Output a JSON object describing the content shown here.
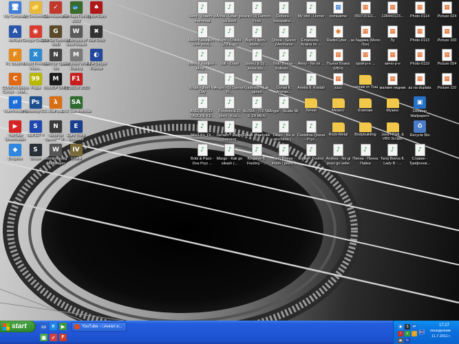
{
  "desktop": {
    "icons": [
      {
        "label": "My Computer",
        "glyph": "🖥",
        "color": "#3f7fd8",
        "kind": "app"
      },
      {
        "label": "My Documents",
        "glyph": "📁",
        "color": "#e9b93c",
        "kind": "app"
      },
      {
        "label": "Checklauncher",
        "glyph": "✓",
        "color": "#c0392b",
        "kind": "app"
      },
      {
        "label": "Pro Bass Fishing 2003",
        "glyph": "🐟",
        "color": "#3a6b2a",
        "kind": "app"
      },
      {
        "label": "PokerStars",
        "glyph": "♠",
        "color": "#b01818",
        "kind": "app"
      },
      {
        "label": "AvRack",
        "glyph": "A",
        "color": "#2a55a8",
        "kind": "app"
      },
      {
        "label": "Google Chrome",
        "glyph": "◉",
        "color": "#d93b2f",
        "kind": "app"
      },
      {
        "label": "GTA SA Turbo XD MoD",
        "glyph": "G",
        "color": "#5a4a2a",
        "kind": "app"
      },
      {
        "label": "In Wheels of Steel Haulin",
        "glyph": "W",
        "color": "#5a5a5a",
        "kind": "app"
      },
      {
        "label": "War Rock",
        "glyph": "✖",
        "color": "#333333",
        "kind": "app"
      },
      {
        "label": "FL Studio 9",
        "glyph": "F",
        "color": "#e58a1c",
        "kind": "app"
      },
      {
        "label": "Xilisoft Free AVI Video...",
        "glyph": "X",
        "color": "#2e8ad0",
        "kind": "app"
      },
      {
        "label": "Need for Speed Nfs",
        "glyph": "N",
        "color": "#444444",
        "kind": "app"
      },
      {
        "label": "Mercedes World Racing",
        "glyph": "M",
        "color": "#7a7a7a",
        "kind": "app"
      },
      {
        "label": "FIFA Simple Parlour",
        "glyph": "◐",
        "color": "#22479c",
        "kind": "app"
      },
      {
        "label": "COWON Media Center - JetA...",
        "glyph": "C",
        "color": "#e0680f",
        "kind": "app"
      },
      {
        "label": "Fraps",
        "glyph": "99",
        "color": "#b8b800",
        "kind": "app"
      },
      {
        "label": "MotoGP URT3",
        "glyph": "M",
        "color": "#1a1a1a",
        "kind": "app"
      },
      {
        "label": "F1 DELIX 2010",
        "glyph": "F1",
        "color": "#c81e1e",
        "kind": "app"
      },
      {
        "label": "TeamViewer 6",
        "glyph": "⇄",
        "color": "#1c6fd8",
        "kind": "app"
      },
      {
        "label": "Photoshop CS...",
        "glyph": "Ps",
        "color": "#1d4f8e",
        "kind": "app"
      },
      {
        "label": "Half-Life",
        "glyph": "λ",
        "color": "#d86f14",
        "kind": "app"
      },
      {
        "label": "GTA San Andreas",
        "glyph": "SA",
        "color": "#2f6b2f",
        "kind": "app"
      },
      {
        "label": "YouTube Downloader",
        "glyph": "▶",
        "color": "#d62424",
        "kind": "app"
      },
      {
        "label": "SUPER ©",
        "glyph": "S",
        "color": "#1e48b0",
        "kind": "app"
      },
      {
        "label": "Need for Speed™ M...",
        "glyph": "N",
        "color": "#3a3a3a",
        "kind": "app"
      },
      {
        "label": "Euro Truck Simulator",
        "glyph": "E",
        "color": "#1b3f8f",
        "kind": "app"
      },
      {
        "label": "Dropbox",
        "glyph": "◆",
        "color": "#2f87e0",
        "kind": "app"
      },
      {
        "label": "Steam",
        "glyph": "S",
        "color": "#2a3038",
        "kind": "app"
      },
      {
        "label": "World Racing Multiplayer",
        "glyph": "W",
        "color": "#555555",
        "kind": "app"
      },
      {
        "label": "GTA 4",
        "glyph": "IV",
        "color": "#7a6a3a",
        "kind": "app"
      },
      {
        "label": "Vanq - Znaem si momenat",
        "glyph": "♪",
        "color": "#1e8a3a",
        "kind": "doc"
      },
      {
        "label": "Anna - Udari go na kivot",
        "glyph": "♪",
        "color": "#1e8a3a",
        "kind": "doc"
      },
      {
        "label": "Vanq i Dj Damon-Prob",
        "glyph": "♪",
        "color": "#1e8a3a",
        "kind": "doc"
      },
      {
        "label": "Debora - Sekspalno ...",
        "glyph": "♪",
        "color": "#1e8a3a",
        "kind": "doc"
      },
      {
        "label": "My Idol - Homer",
        "glyph": "♪",
        "color": "#1e8a3a",
        "kind": "doc"
      },
      {
        "label": "comeatme",
        "glyph": "▦",
        "color": "#2670c8",
        "kind": "img"
      },
      {
        "label": "050720111...",
        "glyph": "▦",
        "color": "#e05a10",
        "kind": "img"
      },
      {
        "label": "128440123...",
        "glyph": "▦",
        "color": "#e05a10",
        "kind": "img"
      },
      {
        "label": "Photo-0114",
        "glyph": "▦",
        "color": "#e05a10",
        "kind": "img"
      },
      {
        "label": "Picture 024",
        "glyph": "▦",
        "color": "#e05a10",
        "kind": "img"
      },
      {
        "label": "Milko Kalaidjiev - Shte povq...",
        "glyph": "♪",
        "color": "#1e8a3a",
        "kind": "doc"
      },
      {
        "label": "Bigni - Chikita (ZU Rap)",
        "glyph": "♪",
        "color": "#1e8a3a",
        "kind": "doc"
      },
      {
        "label": "Bigni Filipov - Malko ...",
        "glyph": "♪",
        "color": "#1e8a3a",
        "kind": "doc"
      },
      {
        "label": "Qnica - Sezon ZAnimanie",
        "glyph": "♪",
        "color": "#1e8a3a",
        "kind": "doc"
      },
      {
        "label": "Emanuela - Kraina mi ...",
        "glyph": "♪",
        "color": "#1e8a3a",
        "kind": "doc"
      },
      {
        "label": "RadioCyber...",
        "glyph": "◉",
        "color": "#d86f14",
        "kind": "img"
      },
      {
        "label": "за бадижа (Мечо Пух)",
        "glyph": "▦",
        "color": "#e05a10",
        "kind": "img"
      },
      {
        "label": "Лу",
        "glyph": "▦",
        "color": "#e05a10",
        "kind": "img"
      },
      {
        "label": "Photo-0113",
        "glyph": "▦",
        "color": "#e05a10",
        "kind": "img"
      },
      {
        "label": "Picture 100",
        "glyph": "▦",
        "color": "#e05a10",
        "kind": "img"
      },
      {
        "label": "Milko Kalaidjiev - Moqt ...",
        "glyph": "♪",
        "color": "#1e8a3a",
        "kind": "doc"
      },
      {
        "label": "Vali - Znam",
        "glyph": "♪",
        "color": "#1e8a3a",
        "kind": "doc"
      },
      {
        "label": "Jamez & Dj ... Jenia Mu...",
        "glyph": "♪",
        "color": "#1e8a3a",
        "kind": "doc"
      },
      {
        "label": "Tedo Boeva - Kolkoto ...",
        "glyph": "♪",
        "color": "#1e8a3a",
        "kind": "doc"
      },
      {
        "label": "Alexy - Ne mi ...",
        "glyph": "♪",
        "color": "#1e8a3a",
        "kind": "doc"
      },
      {
        "label": "Пълни Бозеа (ИБЧ)",
        "glyph": "▦",
        "color": "#e05a10",
        "kind": "img"
      },
      {
        "label": "хрой-р-н ...",
        "glyph": "▦",
        "color": "#e05a10",
        "kind": "img"
      },
      {
        "label": "мечо-р-н",
        "glyph": "▦",
        "color": "#e05a10",
        "kind": "img"
      },
      {
        "label": "Photo-0119",
        "glyph": "▦",
        "color": "#e05a10",
        "kind": "img"
      },
      {
        "label": "Picture 054",
        "glyph": "▦",
        "color": "#e05a10",
        "kind": "img"
      },
      {
        "label": "Xmas - Jhon Ne Day",
        "glyph": "♪",
        "color": "#1e8a3a",
        "kind": "doc"
      },
      {
        "label": "Angel - Dj Damon Pr...",
        "glyph": "♪",
        "color": "#1e8a3a",
        "kind": "doc"
      },
      {
        "label": "Gadinela - Lak ugnes",
        "glyph": "♪",
        "color": "#1e8a3a",
        "kind": "doc"
      },
      {
        "label": "Gynial ft. Aronas...",
        "glyph": "♪",
        "color": "#1e8a3a",
        "kind": "doc"
      },
      {
        "label": "Anelia ft. Kristali ...",
        "glyph": "♪",
        "color": "#1e8a3a",
        "kind": "doc"
      },
      {
        "label": "zzzz",
        "glyph": "▦",
        "color": "#e05a10",
        "kind": "img"
      },
      {
        "label": "чапник от Тош",
        "glyph": "",
        "color": "#e9b93c",
        "kind": "folder"
      },
      {
        "label": "малкия ледник",
        "glyph": "▦",
        "color": "#e05a10",
        "kind": "img"
      },
      {
        "label": "az na duplata",
        "glyph": "▦",
        "color": "#e05a10",
        "kind": "img"
      },
      {
        "label": "Picture 110",
        "glyph": "▦",
        "color": "#e05a10",
        "kind": "img"
      },
      {
        "label": "ANELIA 2011 - TAUCHE KE...",
        "glyph": "♪",
        "color": "#1e8a3a",
        "kind": "doc"
      },
      {
        "label": "Fondora & Dj Jerry - Kos...",
        "glyph": "♪",
        "color": "#1e8a3a",
        "kind": "doc"
      },
      {
        "label": "ALISIA - TOI NE E ZA MEN",
        "glyph": "♪",
        "color": "#1e8a3a",
        "kind": "doc"
      },
      {
        "label": "Angel - Studio Mi",
        "glyph": "♪",
        "color": "#1e8a3a",
        "kind": "doc"
      },
      {
        "label": "Лични",
        "glyph": "",
        "color": "#e9b93c",
        "kind": "folder"
      },
      {
        "label": "Мезист",
        "glyph": "",
        "color": "#e9b93c",
        "kind": "folder"
      },
      {
        "label": "Клипове",
        "glyph": "",
        "color": "#e9b93c",
        "kind": "folder"
      },
      {
        "label": "Музикс",
        "glyph": "",
        "color": "#e9b93c",
        "kind": "folder"
      },
      {
        "label": "Desktop Wallpapers",
        "glyph": "▣",
        "color": "#2670c8",
        "kind": "app"
      },
      {
        "label": "Nils3-Ko_Di...",
        "glyph": "♪",
        "color": "#1e8a3a",
        "kind": "doc"
      },
      {
        "label": "Denaro - Da go napravq",
        "glyph": "♪",
        "color": "#1e8a3a",
        "kind": "doc"
      },
      {
        "label": "Dillan - Narkotik (C...",
        "glyph": "♪",
        "color": "#1e8a3a",
        "kind": "doc"
      },
      {
        "label": "Dillan - Ne si obichana (...",
        "glyph": "♪",
        "color": "#1e8a3a",
        "kind": "doc"
      },
      {
        "label": "Cvetelina Qneva - Pryz...",
        "glyph": "♪",
        "color": "#1e8a3a",
        "kind": "doc"
      },
      {
        "label": "Rock-Metal",
        "glyph": "",
        "color": "#e9b93c",
        "kind": "folder"
      },
      {
        "label": "Bodybuilding",
        "glyph": "",
        "color": "#e9b93c",
        "kind": "folder"
      },
      {
        "label": "Java HTML & VBS Scripts",
        "glyph": "",
        "color": "#e9b93c",
        "kind": "folder"
      },
      {
        "label": "Recycle Bin",
        "glyph": "♻",
        "color": "#4a7cc8",
        "kind": "app"
      },
      {
        "label": "Bobi & Paco - Dva Pryz ...",
        "glyph": "♪",
        "color": "#1e8a3a",
        "kind": "doc"
      },
      {
        "label": "Margo - Kali go sikash (...",
        "glyph": "♪",
        "color": "#1e8a3a",
        "kind": "doc"
      },
      {
        "label": "Kingsize ft. Fisoliny - ...",
        "glyph": "♪",
        "color": "#1e8a3a",
        "kind": "doc"
      },
      {
        "label": "Tanq Boeva - Imam i pesht...",
        "glyph": "♪",
        "color": "#1e8a3a",
        "kind": "doc"
      },
      {
        "label": "Emiliq - Dvoino",
        "glyph": "♪",
        "color": "#1e8a3a",
        "kind": "doc"
      },
      {
        "label": "Andrea - Ne gi pravi go sebe",
        "glyph": "♪",
        "color": "#1e8a3a",
        "kind": "doc"
      },
      {
        "label": "Пинна - Пинна Пайка",
        "glyph": "♪",
        "color": "#1e8a3a",
        "kind": "doc"
      },
      {
        "label": "Tanq Boeva ft. Lady B - ...",
        "glyph": "♪",
        "color": "#1e8a3a",
        "kind": "doc"
      },
      {
        "label": "Славин - Трифонов...",
        "glyph": "♪",
        "color": "#1e8a3a",
        "kind": "doc"
      }
    ]
  },
  "taskbar": {
    "start_label": "start",
    "task_label": "YouTube - □Ангел и...",
    "clock_time": "17:27",
    "clock_day": "понеделник",
    "clock_date": "11.7.2011 г.",
    "lang": "BG",
    "colors": {
      "bar": "#245edb",
      "start": "#3c9a3a",
      "tray": "#0a6fdc"
    }
  }
}
